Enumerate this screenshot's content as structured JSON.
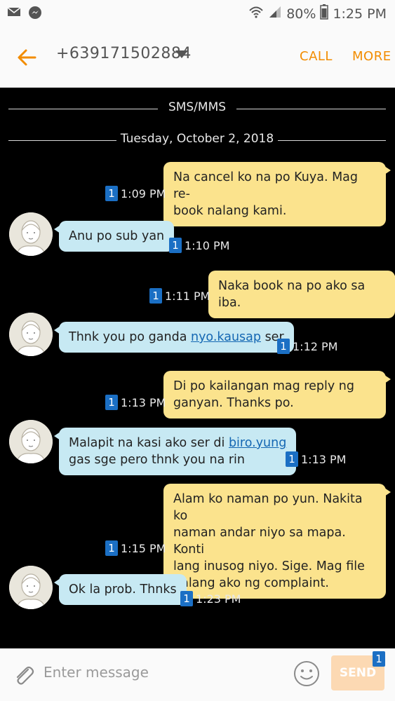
{
  "status_bar": {
    "battery": "80%",
    "time": "1:25 PM",
    "icons": [
      "mail-icon",
      "messenger-icon",
      "wifi-icon",
      "signal-icon",
      "battery-icon"
    ]
  },
  "header": {
    "back_icon": "arrow-left-icon",
    "contact": "+639171502884",
    "call_label": "CALL",
    "more_label": "MORE",
    "accent_color": "#f28c00"
  },
  "conversation": {
    "section_label": "SMS/MMS",
    "date": "Tuesday, October 2, 2018",
    "sim_label": "1",
    "messages": [
      {
        "dir": "out",
        "line1": "Na cancel ko na po Kuya. Mag re-",
        "line2": "book nalang kami.",
        "time": "1:09 PM"
      },
      {
        "dir": "in",
        "text": "Anu po sub yan",
        "time": "1:10 PM"
      },
      {
        "dir": "out",
        "text": "Naka book na po ako sa iba.",
        "time": "1:11 PM"
      },
      {
        "dir": "in",
        "pre": "Thnk you po ganda ",
        "link": "nyo.kausap",
        "post": " ser",
        "time": "1:12 PM"
      },
      {
        "dir": "out",
        "line1": "Di po kailangan mag reply ng",
        "line2": "ganyan. Thanks po.",
        "time": "1:13 PM"
      },
      {
        "dir": "in",
        "pre": "Malapit na kasi ako ser di ",
        "link": "biro.yung",
        "line2": "gas sge pero thnk you na rin",
        "time": "1:13 PM"
      },
      {
        "dir": "out",
        "line1": "Alam ko naman po yun. Nakita ko",
        "line2": "naman andar niyo sa mapa. Konti",
        "line3": "lang inusog niyo. Sige. Mag file",
        "line4": "nalang ako ng complaint.",
        "time": "1:15 PM"
      },
      {
        "dir": "in",
        "text": "Ok la prob. Thnks",
        "time": "1:23 PM"
      }
    ],
    "outgoing_color": "#fbe38d",
    "incoming_color": "#c7e9f3"
  },
  "composer": {
    "placeholder": "Enter message",
    "send_label": "SEND",
    "sim_label": "1",
    "attach_icon": "paperclip-icon",
    "emoji_icon": "smiley-icon"
  }
}
